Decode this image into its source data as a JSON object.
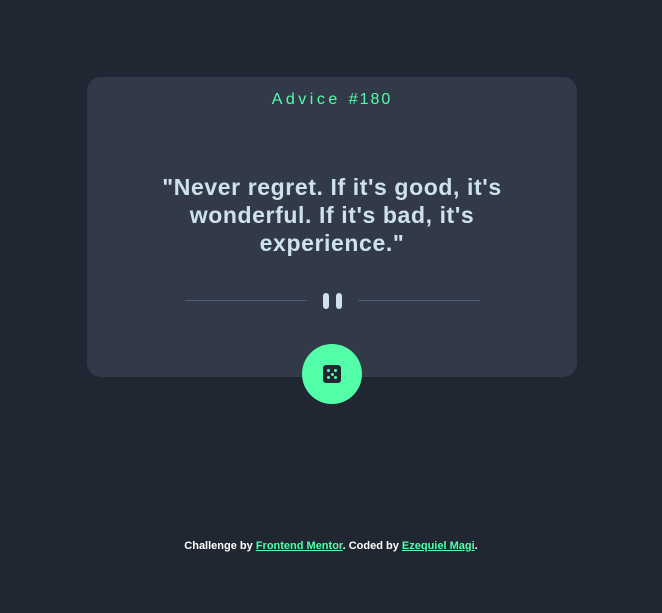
{
  "card": {
    "advice_label": "Advice",
    "advice_number": "#180",
    "quote": "\"Never regret. If it's good, it's wonderful. If it's bad, it's experience.\""
  },
  "dice_button": {
    "icon": "dice-icon"
  },
  "footer": {
    "challenge_prefix": "Challenge by",
    "challenge_link": "Frontend Mentor",
    "coded_prefix": ". Coded by",
    "author_link": "Ezequiel Magi",
    "suffix": "."
  },
  "colors": {
    "background": "#202632",
    "card": "#323a49",
    "accent": "#52ffa8",
    "quote_text": "#cee3e9",
    "divider": "#4f5d74"
  }
}
